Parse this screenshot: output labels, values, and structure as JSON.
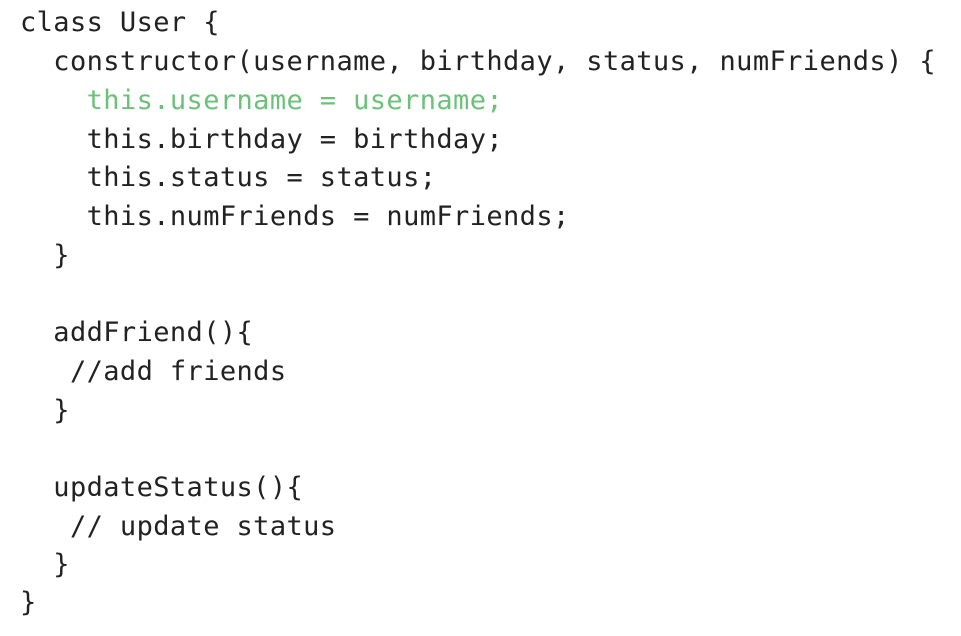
{
  "code": {
    "highlight_color": "#6cc17a",
    "text_color": "#222222",
    "lines": [
      {
        "text": "class User {",
        "highlight": false
      },
      {
        "text": "  constructor(username, birthday, status, numFriends) {",
        "highlight": false
      },
      {
        "text": "    this.username = username;",
        "highlight": true
      },
      {
        "text": "    this.birthday = birthday;",
        "highlight": false
      },
      {
        "text": "    this.status = status;",
        "highlight": false
      },
      {
        "text": "    this.numFriends = numFriends;",
        "highlight": false
      },
      {
        "text": "  }",
        "highlight": false
      },
      {
        "text": "",
        "highlight": false
      },
      {
        "text": "  addFriend(){",
        "highlight": false
      },
      {
        "text": "   //add friends",
        "highlight": false
      },
      {
        "text": "  }",
        "highlight": false
      },
      {
        "text": "",
        "highlight": false
      },
      {
        "text": "  updateStatus(){",
        "highlight": false
      },
      {
        "text": "   // update status",
        "highlight": false
      },
      {
        "text": "  }",
        "highlight": false
      },
      {
        "text": "}",
        "highlight": false
      }
    ]
  }
}
